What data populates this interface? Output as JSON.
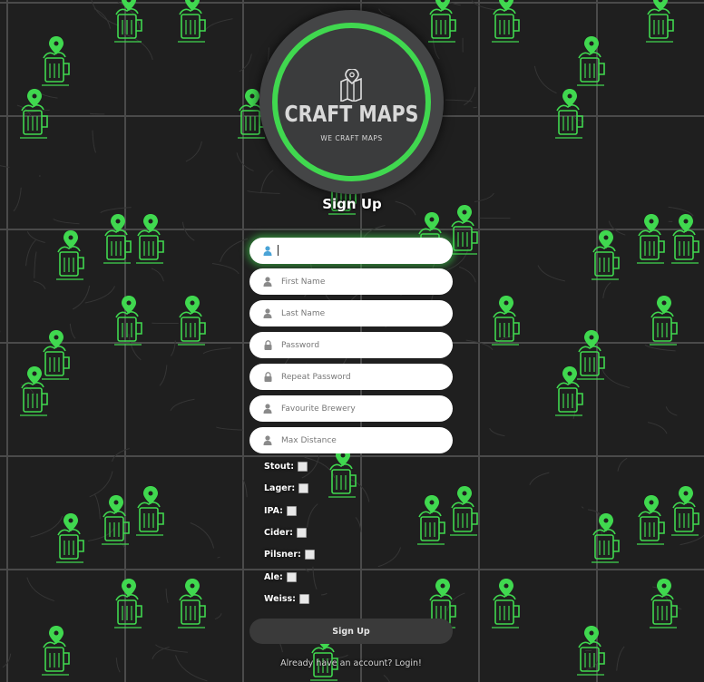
{
  "logo": {
    "title": "CRAFT MAPS",
    "tagline": "WE CRAFT MAPS"
  },
  "form": {
    "title": "Sign Up",
    "fields": [
      {
        "name": "username",
        "value": "",
        "placeholder": "",
        "icon": "user-icon"
      },
      {
        "name": "first-name",
        "value": "",
        "placeholder": "First Name",
        "icon": "user-icon"
      },
      {
        "name": "last-name",
        "value": "",
        "placeholder": "Last Name",
        "icon": "user-icon"
      },
      {
        "name": "password",
        "value": "",
        "placeholder": "Password",
        "icon": "lock-icon"
      },
      {
        "name": "repeat-password",
        "value": "",
        "placeholder": "Repeat Password",
        "icon": "lock-icon"
      },
      {
        "name": "favourite-brewery",
        "value": "",
        "placeholder": "Favourite Brewery",
        "icon": "user-icon"
      },
      {
        "name": "max-distance",
        "value": "",
        "placeholder": "Max Distance",
        "icon": "user-icon"
      }
    ],
    "beer_types": [
      {
        "label": "Stout:",
        "checked": false
      },
      {
        "label": "Lager:",
        "checked": false
      },
      {
        "label": "IPA:",
        "checked": false
      },
      {
        "label": "Cider:",
        "checked": false
      },
      {
        "label": "Pilsner:",
        "checked": false
      },
      {
        "label": "Ale:",
        "checked": false
      },
      {
        "label": "Weiss:",
        "checked": false
      }
    ],
    "submit_label": "Sign Up",
    "login_text": "Already have an account? Login!"
  },
  "colors": {
    "accent": "#40d84f",
    "background": "#1f1f1f",
    "input_bg": "#ffffff",
    "button_bg": "#3a3a3a"
  }
}
